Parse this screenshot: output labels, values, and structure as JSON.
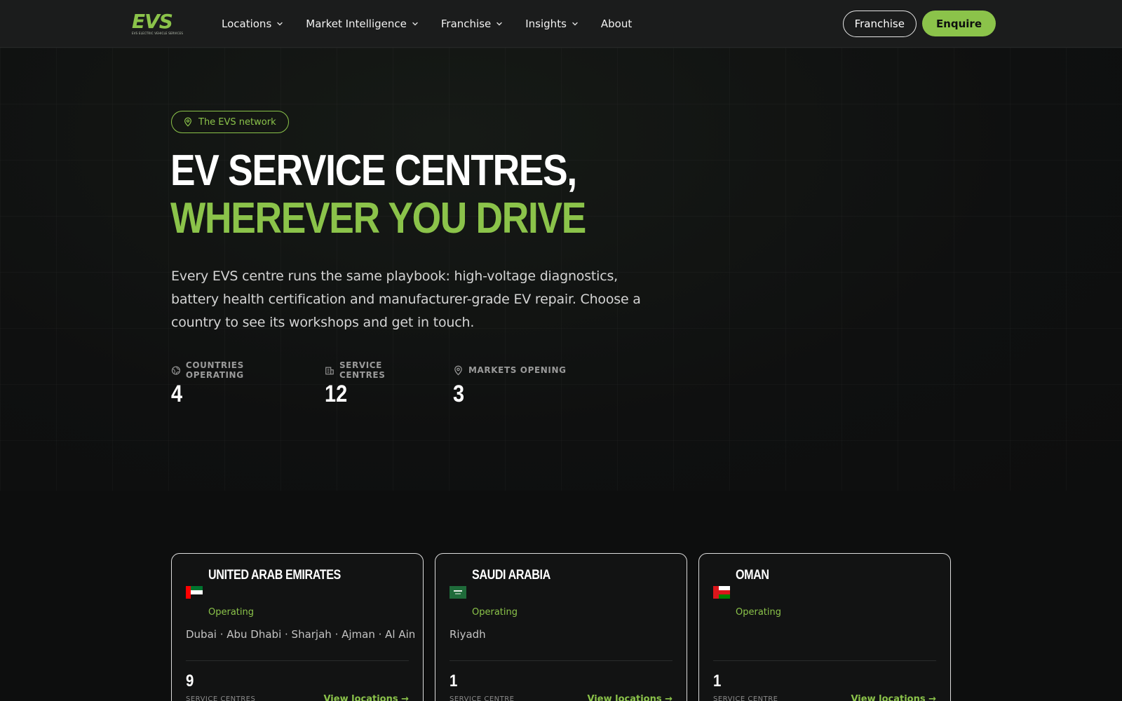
{
  "brand": {
    "logo_text": "EVS",
    "logo_tagline": "EVS ELECTRIC VEHICLE SERVICES",
    "accent_color": "#8bc34a"
  },
  "nav": {
    "items": [
      {
        "label": "Locations",
        "has_dropdown": true
      },
      {
        "label": "Market Intelligence",
        "has_dropdown": true
      },
      {
        "label": "Franchise",
        "has_dropdown": true
      },
      {
        "label": "Insights",
        "has_dropdown": true
      },
      {
        "label": "About",
        "has_dropdown": false
      }
    ],
    "franchise_button": "Franchise",
    "enquire_button": "Enquire"
  },
  "hero": {
    "badge": "The EVS network",
    "title_main": "EV service centres, ",
    "title_accent": "wherever you drive",
    "subtitle": "Every EVS centre runs the same playbook: high-voltage diagnostics, battery health certification and manufacturer-grade EV repair. Choose a country to see its workshops and get in touch.",
    "stats": [
      {
        "label": "Countries operating",
        "value": "4",
        "icon": "globe-icon"
      },
      {
        "label": "Service centres",
        "value": "12",
        "icon": "building-icon"
      },
      {
        "label": "Markets opening",
        "value": "3",
        "icon": "map-pin-icon"
      }
    ]
  },
  "countries": [
    {
      "name": "United Arab Emirates",
      "flag": "uae-flag-icon",
      "status": "Operating",
      "cities": "Dubai · Abu Dhabi · Sharjah · Ajman · Al Ain",
      "count": "9",
      "count_label": "Service centres",
      "link": "View locations →"
    },
    {
      "name": "Saudi Arabia",
      "flag": "saudi-flag-icon",
      "status": "Operating",
      "cities": "Riyadh",
      "count": "1",
      "count_label": "Service centre",
      "link": "View locations →"
    },
    {
      "name": "Oman",
      "flag": "oman-flag-icon",
      "status": "Operating",
      "cities": "",
      "count": "1",
      "count_label": "Service centre",
      "link": "View locations →"
    }
  ]
}
